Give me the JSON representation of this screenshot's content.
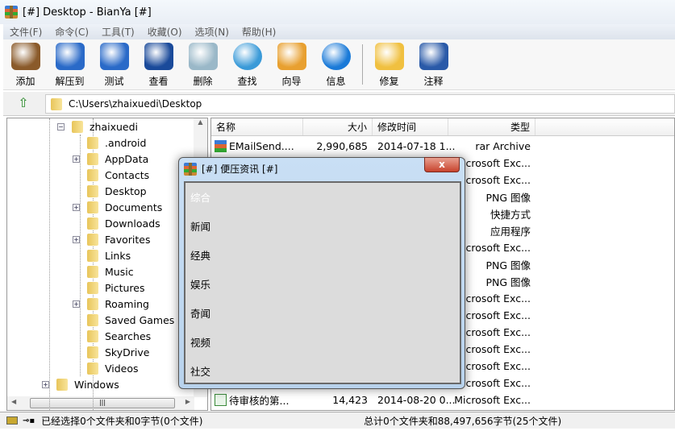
{
  "window": {
    "title": "[#] Desktop - BianYa [#]"
  },
  "menu": [
    "文件(F)",
    "命令(C)",
    "工具(T)",
    "收藏(O)",
    "选项(N)",
    "帮助(H)"
  ],
  "toolbar": [
    {
      "label": "添加",
      "icon": "add-archive-icon",
      "color": "#8a5a2a"
    },
    {
      "label": "解压到",
      "icon": "extract-folder-icon",
      "color": "#2a6ac8"
    },
    {
      "label": "测试",
      "icon": "test-check-icon",
      "color": "#2a6ac8"
    },
    {
      "label": "查看",
      "icon": "binoculars-icon",
      "color": "#1a4a9a"
    },
    {
      "label": "删除",
      "icon": "recycle-bin-icon",
      "color": "#9ab8c8"
    },
    {
      "label": "查找",
      "icon": "magnifier-icon",
      "color": "#3a9ad8"
    },
    {
      "label": "向导",
      "icon": "wizard-person-icon",
      "color": "#e8a030"
    },
    {
      "label": "信息",
      "icon": "info-icon",
      "color": "#1a7ad8"
    },
    {
      "label": "修复",
      "icon": "first-aid-icon",
      "color": "#f0c040"
    },
    {
      "label": "注释",
      "icon": "clipboard-pen-icon",
      "color": "#2a5aa8"
    }
  ],
  "address": {
    "path": "C:\\Users\\zhaixuedi\\Desktop"
  },
  "tree": {
    "root": {
      "label": "zhaixuedi",
      "expanded": true
    },
    "children": [
      {
        "label": ".android",
        "plus": false
      },
      {
        "label": "AppData",
        "plus": true
      },
      {
        "label": "Contacts",
        "plus": false
      },
      {
        "label": "Desktop",
        "plus": false
      },
      {
        "label": "Documents",
        "plus": true
      },
      {
        "label": "Downloads",
        "plus": false
      },
      {
        "label": "Favorites",
        "plus": true
      },
      {
        "label": "Links",
        "plus": false
      },
      {
        "label": "Music",
        "plus": false
      },
      {
        "label": "Pictures",
        "plus": false
      },
      {
        "label": "Roaming",
        "plus": true
      },
      {
        "label": "Saved Games",
        "plus": false
      },
      {
        "label": "Searches",
        "plus": false
      },
      {
        "label": "SkyDrive",
        "plus": false
      },
      {
        "label": "Videos",
        "plus": false
      }
    ],
    "sibling": {
      "label": "Windows",
      "plus": true
    }
  },
  "list": {
    "columns": [
      "名称",
      "大小",
      "修改时间",
      "类型"
    ],
    "rows": [
      {
        "name": "EMailSend....",
        "size": "2,990,685",
        "date": "2014-07-18 1...",
        "type": "rar Archive",
        "icon": "rar-file-icon"
      },
      {
        "type": "Microsoft Exc..."
      },
      {
        "type": "Microsoft Exc..."
      },
      {
        "type": "PNG 图像"
      },
      {
        "type": "快捷方式"
      },
      {
        "type": "应用程序"
      },
      {
        "type": "Microsoft Exc..."
      },
      {
        "type": "PNG 图像"
      },
      {
        "type": "PNG 图像"
      },
      {
        "type": "Microsoft Exc..."
      },
      {
        "type": "Microsoft Exc..."
      },
      {
        "type": "Microsoft Exc..."
      },
      {
        "type": "Microsoft Exc..."
      },
      {
        "type": "Microsoft Exc..."
      },
      {
        "type": "Microsoft Exc..."
      },
      {
        "name": "待审核的第...",
        "size": "14,423",
        "date": "2014-08-20 0...",
        "type": "Microsoft Exc...",
        "icon": "excel-file-icon"
      }
    ]
  },
  "status": {
    "left": "已经选择0个文件夹和0字节(0个文件)",
    "right": "总计0个文件夹和88,497,656字节(25个文件)"
  },
  "dialog": {
    "title": "[#] 便压资讯 [#]",
    "close": "x",
    "items": [
      "综合",
      "新闻",
      "经典",
      "娱乐",
      "奇闻",
      "视频",
      "社交"
    ],
    "active_index": 0
  }
}
